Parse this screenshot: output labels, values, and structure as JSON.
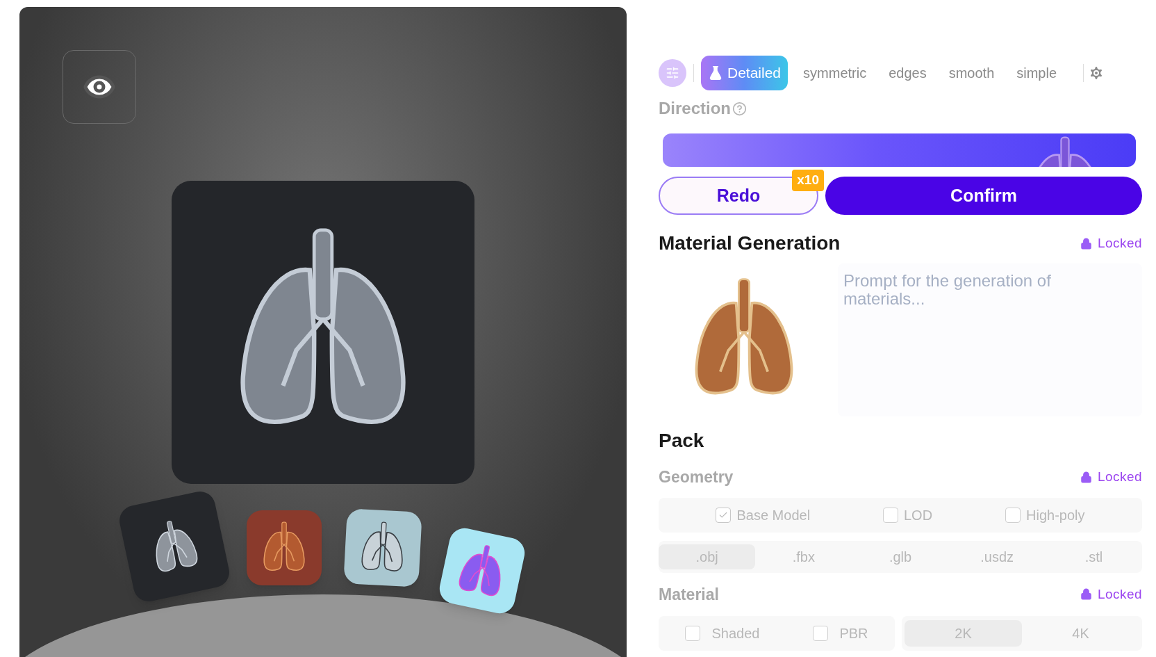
{
  "toolbar": {
    "styles": [
      {
        "label": "Detailed",
        "selected": true
      },
      {
        "label": "symmetric",
        "selected": false
      },
      {
        "label": "edges",
        "selected": false
      },
      {
        "label": "smooth",
        "selected": false
      },
      {
        "label": "simple",
        "selected": false
      }
    ]
  },
  "direction": {
    "label": "Direction"
  },
  "actions": {
    "redo": {
      "label": "Redo",
      "badge": "x10"
    },
    "confirm": {
      "label": "Confirm"
    }
  },
  "material_generation": {
    "title": "Material Generation",
    "status": "Locked",
    "prompt": {
      "placeholder": "Prompt for the generation of materials..."
    }
  },
  "pack": {
    "title": "Pack",
    "geometry": {
      "label": "Geometry",
      "status": "Locked",
      "options": [
        {
          "label": "Base Model",
          "checked": true
        },
        {
          "label": "LOD",
          "checked": false
        },
        {
          "label": "High-poly",
          "checked": false
        }
      ],
      "formats": [
        {
          "label": ".obj",
          "selected": true
        },
        {
          "label": ".fbx",
          "selected": false
        },
        {
          "label": ".glb",
          "selected": false
        },
        {
          "label": ".usdz",
          "selected": false
        },
        {
          "label": ".stl",
          "selected": false
        }
      ]
    },
    "material": {
      "label": "Material",
      "status": "Locked",
      "options": [
        {
          "label": "Shaded",
          "checked": false
        },
        {
          "label": "PBR",
          "checked": false
        }
      ],
      "resolutions": [
        {
          "label": "2K",
          "selected": true
        },
        {
          "label": "4K",
          "selected": false
        }
      ]
    }
  }
}
